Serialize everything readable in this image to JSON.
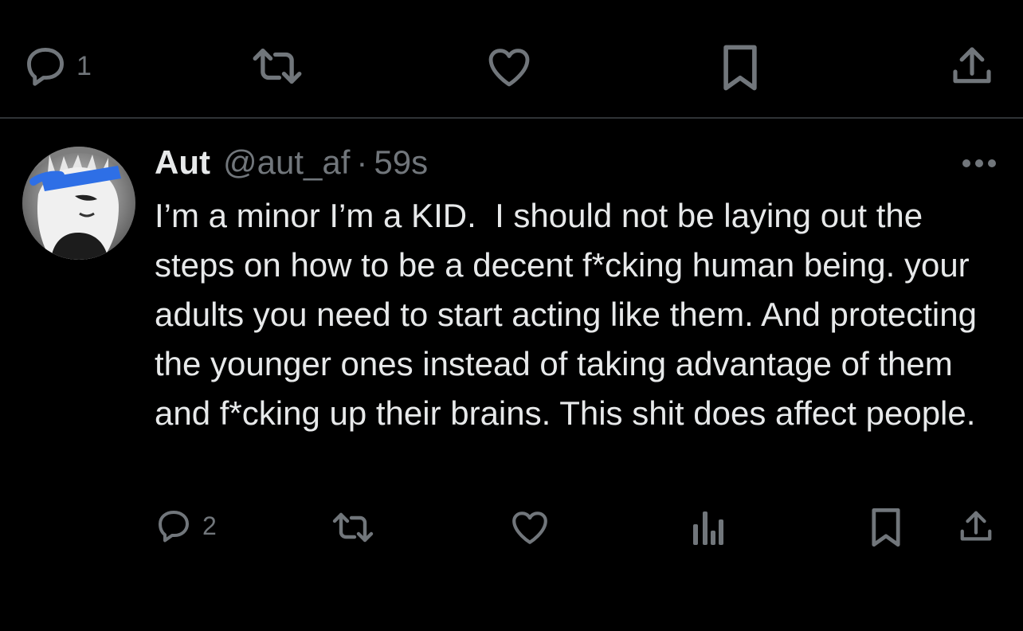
{
  "prev_tweet": {
    "reply_count": "1"
  },
  "tweet": {
    "display_name": "Aut",
    "handle": "@aut_af",
    "separator": "·",
    "time": "59s",
    "text": "I’m a minor I’m a KID.  I should not be laying out the steps on how to be a decent f*cking human being. your adults you need to start acting like them. And protecting the younger ones instead of taking advantage of them and f*cking up their brains. This shit does affect people.",
    "reply_count": "2"
  },
  "icons": {
    "reply": "reply-icon",
    "retweet": "retweet-icon",
    "like": "like-icon",
    "views": "views-icon",
    "bookmark": "bookmark-icon",
    "share": "share-icon",
    "more": "more-icon"
  },
  "colors": {
    "background": "#000000",
    "text": "#e7e9ea",
    "muted": "#71767b",
    "divider": "#2f3336",
    "avatar_highlight": "#2e6fe6"
  }
}
